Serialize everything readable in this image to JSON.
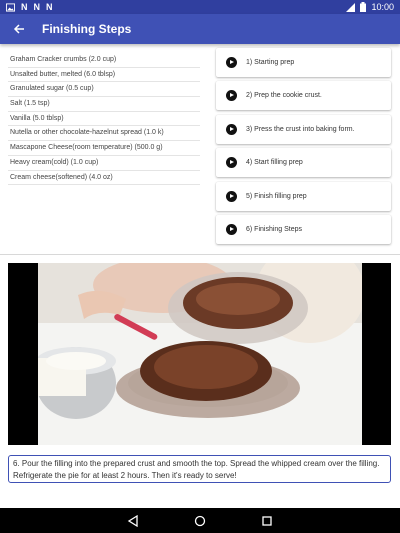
{
  "status_bar": {
    "left_icons": [
      "image-icon",
      "n-notification-icon",
      "n-notification-icon",
      "n-notification-icon"
    ],
    "time": "10:00"
  },
  "app_bar": {
    "title": "Finishing Steps"
  },
  "ingredients": [
    "Graham Cracker crumbs  (2.0 cup)",
    "Unsalted butter, melted  (6.0 tblsp)",
    "Granulated sugar  (0.5 cup)",
    "Salt  (1.5 tsp)",
    "Vanilla  (5.0 tblsp)",
    "Nutella or other chocolate-hazelnut spread  (1.0 k)",
    "Mascapone Cheese(room temperature)  (500.0 g)",
    "Heavy cream(cold)  (1.0 cup)",
    "Cream cheese(softened)  (4.0 oz)"
  ],
  "steps": [
    "1) Starting prep",
    "2) Prep the cookie crust.",
    "3) Press the crust into baking form.",
    "4) Start filling prep",
    "5) Finish filling prep",
    "6) Finishing Steps"
  ],
  "caption": "6. Pour the filling into the prepared crust and smooth the top. Spread the whipped cream over the filling. Refrigerate the pie for at least 2 hours. Then it's ready to serve!",
  "colors": {
    "primary": "#3f51b5",
    "primary_dark": "#303f9f"
  }
}
